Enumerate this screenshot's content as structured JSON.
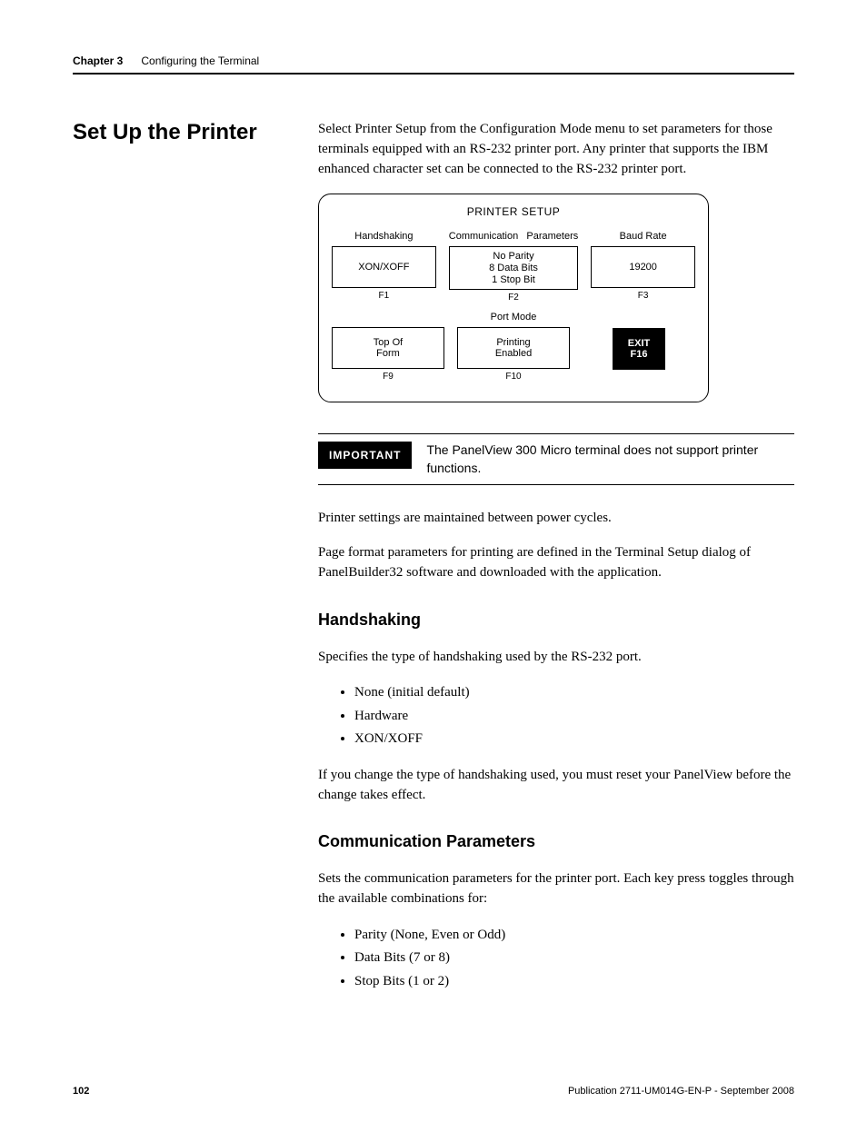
{
  "header": {
    "chapter_label": "Chapter 3",
    "chapter_title": "Configuring the Terminal"
  },
  "section_heading": "Set Up the Printer",
  "intro_para": "Select Printer Setup from the Configuration Mode menu to set parameters for those terminals equipped with an RS-232 printer port. Any printer that supports the IBM enhanced character set can be connected to the RS-232 printer port.",
  "diagram": {
    "title": "PRINTER SETUP",
    "row1": {
      "c1": {
        "label": "Handshaking",
        "box": "XON/XOFF",
        "fkey": "F1"
      },
      "c2": {
        "label_a": "Communication",
        "label_b": "Parameters",
        "box_l1": "No Parity",
        "box_l2": "8 Data Bits",
        "box_l3": "1 Stop Bit",
        "fkey": "F2"
      },
      "c3": {
        "label": "Baud Rate",
        "box": "19200",
        "fkey": "F3"
      }
    },
    "row2": {
      "c1": {
        "box_l1": "Top Of",
        "box_l2": "Form",
        "fkey": "F9"
      },
      "c2": {
        "label": "Port Mode",
        "box_l1": "Printing",
        "box_l2": "Enabled",
        "fkey": "F10"
      },
      "c3": {
        "exit_l1": "EXIT",
        "exit_l2": "F16"
      }
    }
  },
  "important": {
    "badge": "IMPORTANT",
    "text": "The PanelView 300 Micro terminal does not support printer functions."
  },
  "para2": "Printer settings are maintained between power cycles.",
  "para3": "Page format parameters for printing are defined in the Terminal Setup dialog of PanelBuilder32 software and downloaded with the application.",
  "handshaking": {
    "heading": "Handshaking",
    "para": "Specifies the type of handshaking used by the RS-232 port.",
    "items": [
      "None (initial default)",
      "Hardware",
      "XON/XOFF"
    ],
    "para2": "If you change the type of handshaking used, you must reset your PanelView before the change takes effect."
  },
  "comm": {
    "heading": "Communication Parameters",
    "para": "Sets the communication parameters for the printer port. Each key press toggles through the available combinations for:",
    "items": [
      "Parity (None, Even or Odd)",
      "Data Bits (7 or 8)",
      "Stop Bits (1 or 2)"
    ]
  },
  "footer": {
    "page": "102",
    "pub": "Publication 2711-UM014G-EN-P - September 2008"
  }
}
